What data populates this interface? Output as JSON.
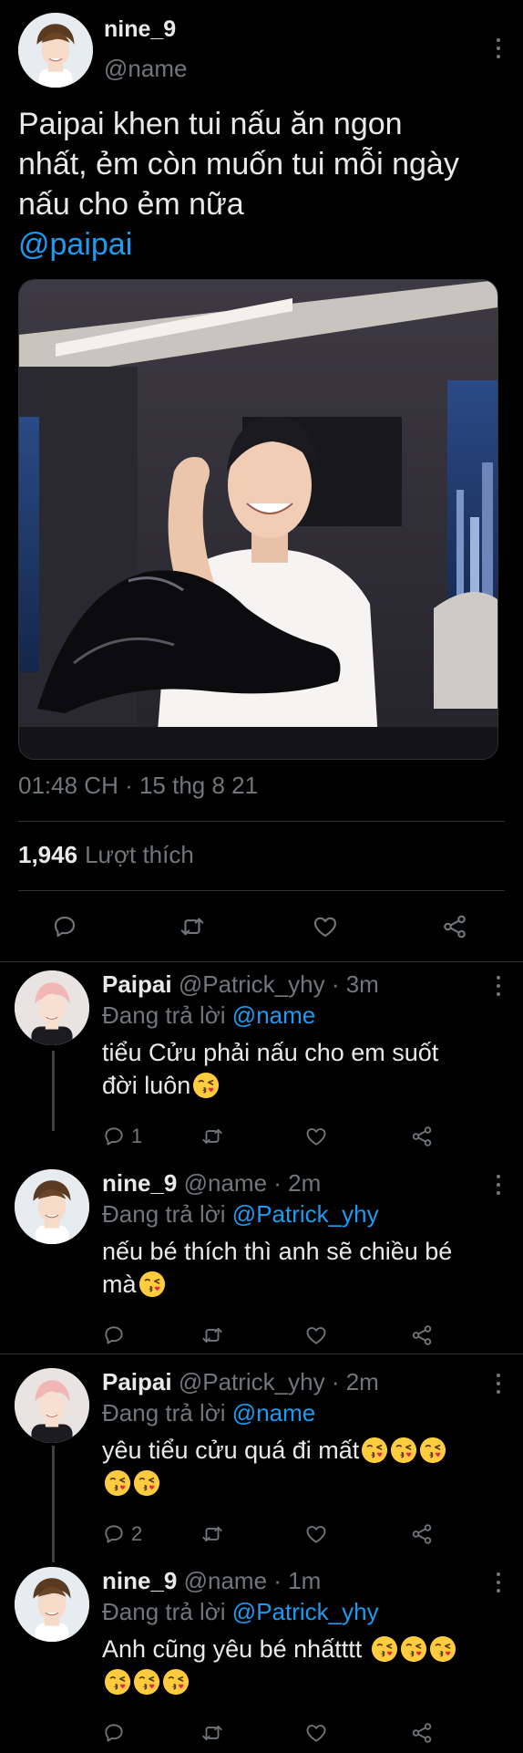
{
  "main": {
    "name": "nine_9",
    "handle": "@name",
    "text_lines": [
      "Paipai khen tui nấu ăn ngon",
      "nhất, ẻm còn muốn tui mỗi ngày",
      "nấu cho ẻm nữa"
    ],
    "mention": "@paipai",
    "timestamp": "01:48 CH · 15 thg 8 21",
    "likes_count": "1,946",
    "likes_label": "Lượt thích"
  },
  "replies": [
    {
      "name": "Paipai",
      "meta": "@Patrick_yhy · 3m",
      "replying_prefix": "Đang trả lời",
      "replying_to": "@name",
      "text_lines": [
        "tiểu Cửu phải nấu cho em suốt",
        "đời luôn"
      ],
      "emoji_counts": [
        0,
        1
      ],
      "reply_count": "1"
    },
    {
      "name": "nine_9",
      "meta": "@name · 2m",
      "replying_prefix": "Đang trả lời",
      "replying_to": "@Patrick_yhy",
      "text_lines": [
        "nếu bé thích thì anh sẽ chiều bé",
        "mà"
      ],
      "emoji_counts": [
        0,
        1
      ],
      "reply_count": ""
    },
    {
      "name": "Paipai",
      "meta": "@Patrick_yhy · 2m",
      "replying_prefix": "Đang trả lời",
      "replying_to": "@name",
      "text_lines": [
        "yêu tiểu cửu quá đi mất",
        ""
      ],
      "emoji_counts": [
        3,
        2
      ],
      "reply_count": "2"
    },
    {
      "name": "nine_9",
      "meta": "@name · 1m",
      "replying_prefix": "Đang trả lời",
      "replying_to": "@Patrick_yhy",
      "text_lines": [
        "Anh cũng yêu bé nhấtttt ",
        ""
      ],
      "emoji_counts": [
        3,
        3
      ],
      "reply_count": ""
    }
  ],
  "icons": {
    "reply": "reply-icon",
    "retweet": "retweet-icon",
    "like": "heart-icon",
    "share": "share-icon",
    "more": "more-icon",
    "emoji": "face-blowing-kiss-icon"
  },
  "colors": {
    "background": "#000000",
    "text": "#e7e9ea",
    "secondary": "#71767b",
    "accent": "#1d9bf0",
    "divider": "#2f3336"
  }
}
